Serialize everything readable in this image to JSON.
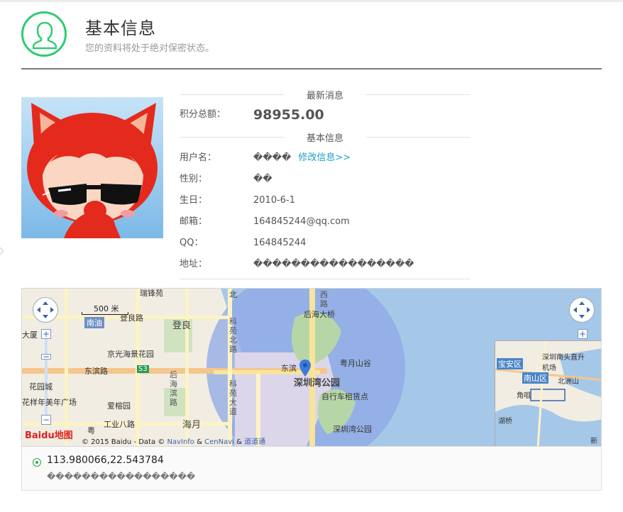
{
  "header": {
    "title": "基本信息",
    "subtitle": "您的资料将处于绝对保密状态。",
    "icon": "user-icon"
  },
  "sections": {
    "latest": "最新消息",
    "basic": "基本信息"
  },
  "points": {
    "label": "积分总额：",
    "value": "98955.00"
  },
  "profile": {
    "username_label": "用户名：",
    "username_value": "����",
    "edit_link": "修改信息>>",
    "gender_label": "性别：",
    "gender_value": "��",
    "birthday_label": "生日：",
    "birthday_value": "2010-6-1",
    "email_label": "邮箱：",
    "email_value": "164845244@qq.com",
    "qq_label": "QQ：",
    "qq_value": "164845244",
    "address_label": "地址：",
    "address_value": "�����������������"
  },
  "map": {
    "scale": "500 米",
    "copyright_prefix": "© 2015 Baidu - Data ©",
    "copyright_link1": "NavInfo",
    "copyright_amp": "&",
    "copyright_link2": "CenNavi",
    "copyright_amp2": "&",
    "copyright_link3": "道道通",
    "brand": "Baidu地图",
    "labels": {
      "ruifeng": "瑞锋苑",
      "houhai_bridge": "后海大桥",
      "nanyou": "南油",
      "dengliang_road": "登良路",
      "dengliang": "登良",
      "jingguang": "京光海景花园",
      "dongbin": "东滨路",
      "s3": "S3",
      "dongbin2": "东滨",
      "yueyue": "粤月山谷",
      "shenzhen_bay_park": "深圳湾公园",
      "bike": "自行车租赁点",
      "huacheng": "花园城",
      "huashu": "花样年美年广场",
      "aixiang": "爱榕园",
      "gongye8": "工业八路",
      "haiyue": "海月",
      "sz_park2": "深圳湾公园",
      "dasha": "大厦",
      "houhai_v": "后海滨路",
      "keyuan_north": "科苑北路",
      "keyuan_ave": "科苑大道",
      "xi": "西路",
      "ru": "粤",
      "north_label": "北"
    },
    "overview": {
      "baoan": "宝安区",
      "nanshan": "南山区",
      "airport": "深圳南头直升机场",
      "beizhou": "北洲山",
      "jiaozui": "角咀",
      "hukou": "湖桥",
      "xin": "新"
    }
  },
  "location": {
    "coordinates": "113.980066,22.543784",
    "address": "�����������������"
  },
  "colors": {
    "accent_green": "#2ecc71",
    "points_red": "#e02020",
    "link_blue": "#1ca0c8",
    "water": "#a6c8e8",
    "district_circle": "#8ea8e6"
  }
}
